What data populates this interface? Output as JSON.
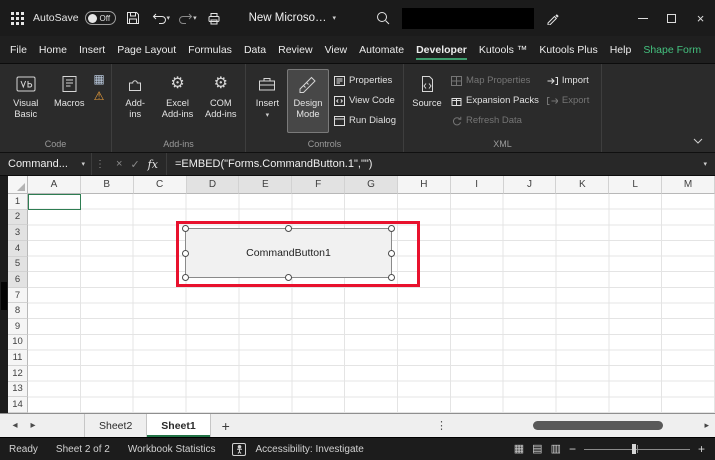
{
  "title_bar": {
    "autosave_label": "AutoSave",
    "autosave_state": "Off",
    "doc_title": "New Microso…"
  },
  "ribbon_tabs": [
    {
      "label": "File"
    },
    {
      "label": "Home"
    },
    {
      "label": "Insert"
    },
    {
      "label": "Page Layout"
    },
    {
      "label": "Formulas"
    },
    {
      "label": "Data"
    },
    {
      "label": "Review"
    },
    {
      "label": "View"
    },
    {
      "label": "Automate"
    },
    {
      "label": "Developer",
      "active": true
    },
    {
      "label": "Kutools ™"
    },
    {
      "label": "Kutools Plus"
    },
    {
      "label": "Help"
    },
    {
      "label": "Shape Form",
      "accent": true
    }
  ],
  "ribbon": {
    "code": {
      "visual_basic": "Visual Basic",
      "macros": "Macros",
      "group_label": "Code"
    },
    "addins": {
      "addins_button": "Add-ins",
      "excel_addins": "Excel Add-ins",
      "com_addins": "COM Add-ins",
      "group_label": "Add-ins"
    },
    "controls": {
      "insert": "Insert",
      "design_mode": "Design Mode",
      "properties": "Properties",
      "view_code": "View Code",
      "run_dialog": "Run Dialog",
      "group_label": "Controls"
    },
    "xml": {
      "source": "Source",
      "map_properties": "Map Properties",
      "expansion_packs": "Expansion Packs",
      "refresh_data": "Refresh Data",
      "import": "Import",
      "export": "Export",
      "group_label": "XML"
    }
  },
  "formula_bar": {
    "name_box_value": "Command...",
    "fx_label": "fx",
    "formula": "=EMBED(\"Forms.CommandButton.1\",\"\")"
  },
  "grid": {
    "columns": [
      "A",
      "B",
      "C",
      "D",
      "E",
      "F",
      "G",
      "H",
      "I",
      "J",
      "K",
      "L",
      "M"
    ],
    "rows": [
      "1",
      "2",
      "3",
      "4",
      "5",
      "6",
      "7",
      "8",
      "9",
      "10",
      "11",
      "12",
      "13",
      "14"
    ],
    "highlight_columns": [
      "D",
      "E",
      "F",
      "G"
    ],
    "highlight_rows": [
      "2",
      "3",
      "4",
      "5",
      "6"
    ],
    "command_button_label": "CommandButton1"
  },
  "sheet_tabs": {
    "tabs": [
      {
        "label": "Sheet2"
      },
      {
        "label": "Sheet1",
        "active": true
      }
    ],
    "add_label": "+"
  },
  "status_bar": {
    "ready": "Ready",
    "sheet_info": "Sheet 2 of 2",
    "workbook_statistics": "Workbook Statistics",
    "accessibility": "Accessibility: Investigate"
  },
  "icons": {
    "dropdown": "▾",
    "resizer": "⋮",
    "cancel": "×",
    "confirm": "✓",
    "gear": "⚙",
    "warning": "⚠",
    "grid": "▦",
    "tab_left": "◂",
    "tab_right": "▸",
    "minus": "−",
    "plus": "+",
    "close": "×",
    "view_normal": "▦",
    "view_layout": "▤",
    "view_break": "▥"
  },
  "colors": {
    "accent_green": "#217346",
    "annotation_red": "#e8112d",
    "tab_accent_green": "#44c07e",
    "warning_orange": "#f0a23c"
  }
}
